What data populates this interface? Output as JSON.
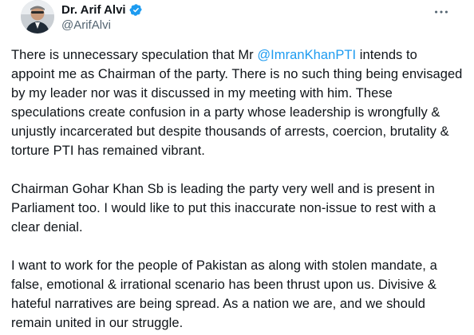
{
  "author": {
    "display_name": "Dr. Arif Alvi",
    "handle": "@ArifAlvi",
    "verified": true,
    "verified_color": "#1d9bf0"
  },
  "icons": {
    "avatar": "profile-photo",
    "verified": "verified-badge-icon",
    "more": "more-options-icon"
  },
  "tweet": {
    "p1": {
      "before": "There is unnecessary speculation that Mr ",
      "mention": "@ImranKhanPTI",
      "after": " intends to appoint me as Chairman of the party.  There is no such thing being envisaged by my leader nor was it discussed in my meeting with him. These speculations create confusion in a party whose leadership is wrongfully & unjustly incarcerated but despite thousands of arrests, coercion, brutality & torture PTI has remained vibrant."
    },
    "p2": "Chairman Gohar Khan Sb is leading the party very well and is present in Parliament too. I would like to put this inaccurate non-issue to rest with a clear denial.",
    "p3": "I want to work for the people of Pakistan as along with stolen mandate, a false, emotional & irrational scenario has been thrust upon us. Divisive & hateful narratives are being spread. As a nation we are, and we should remain united in our struggle."
  },
  "colors": {
    "text": "#0f1419",
    "secondary": "#536471",
    "link": "#1d9bf0"
  }
}
